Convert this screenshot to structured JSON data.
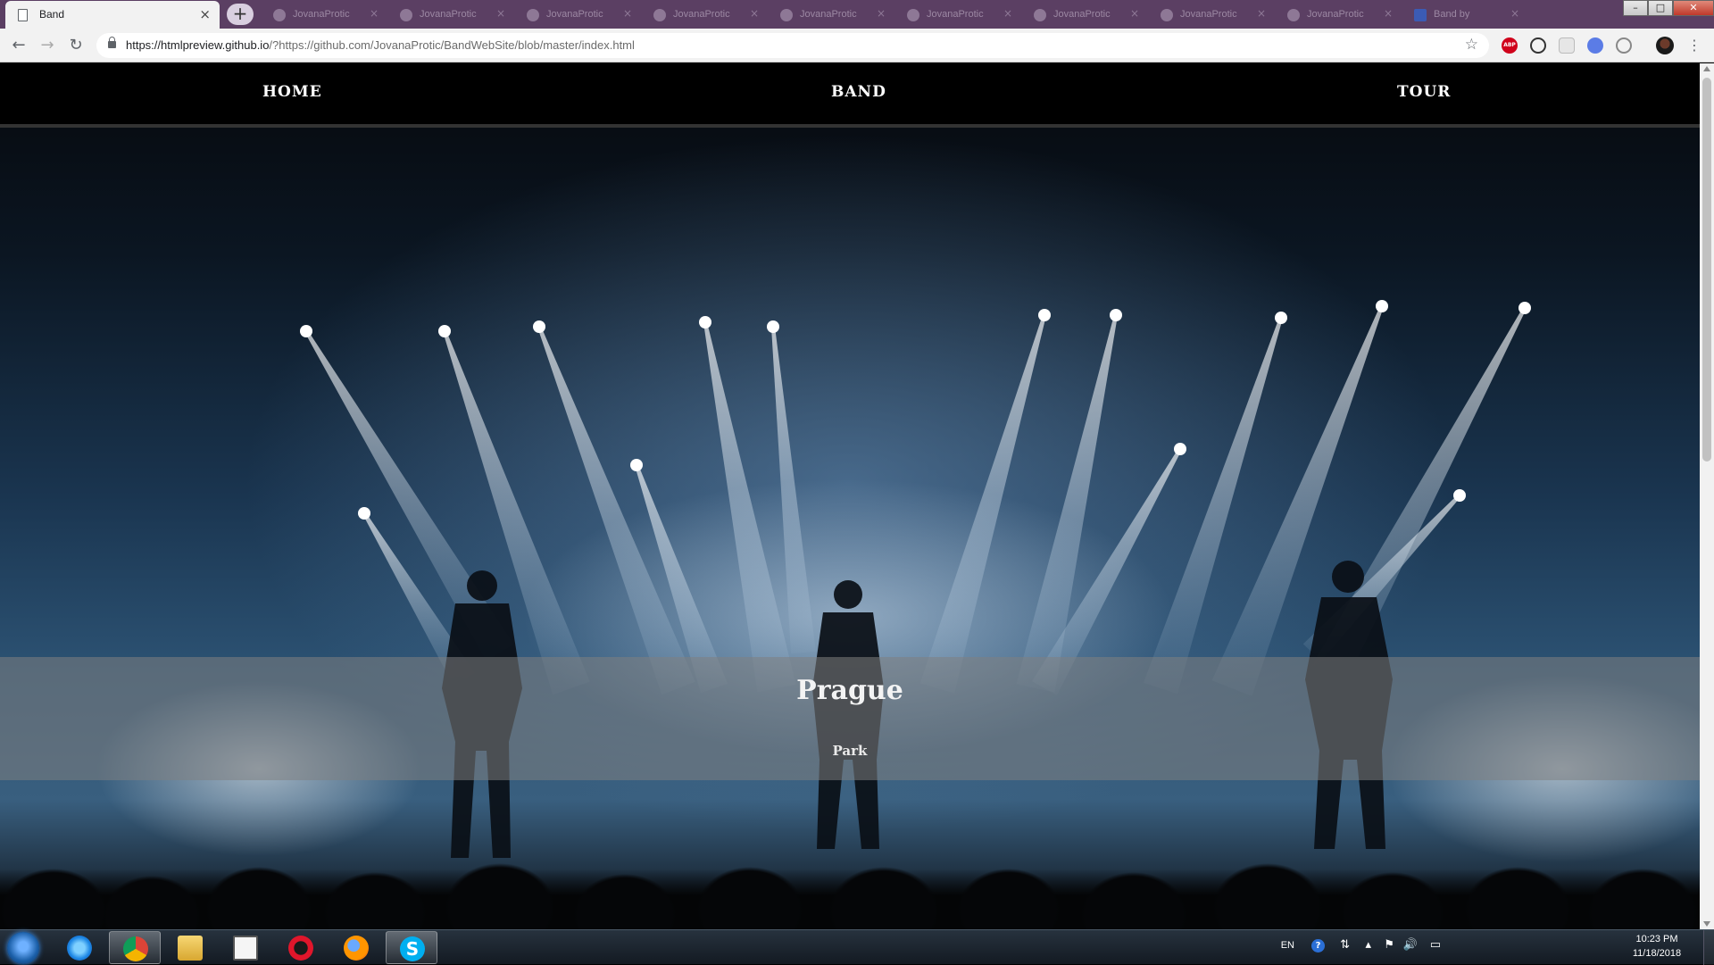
{
  "browser": {
    "active_tab_title": "Band",
    "background_tab_title": "JovanaProtic",
    "last_tab_title": "Band by",
    "url_host": "https://htmlpreview.github.io",
    "url_rest": "/?https://github.com/JovanaProtic/BandWebSite/blob/master/index.html"
  },
  "site": {
    "nav": {
      "home": "HOME",
      "band": "BAND",
      "tour": "TOUR"
    },
    "banner": {
      "city": "Prague",
      "venue": "Park"
    }
  },
  "taskbar": {
    "language": "EN",
    "time": "10:23 PM",
    "date": "11/18/2018"
  },
  "colors": {
    "nav_bg": "#000000",
    "banner_overlay": "rgba(128,128,128,0.55)",
    "chrome_frame": "#5b3f63"
  }
}
